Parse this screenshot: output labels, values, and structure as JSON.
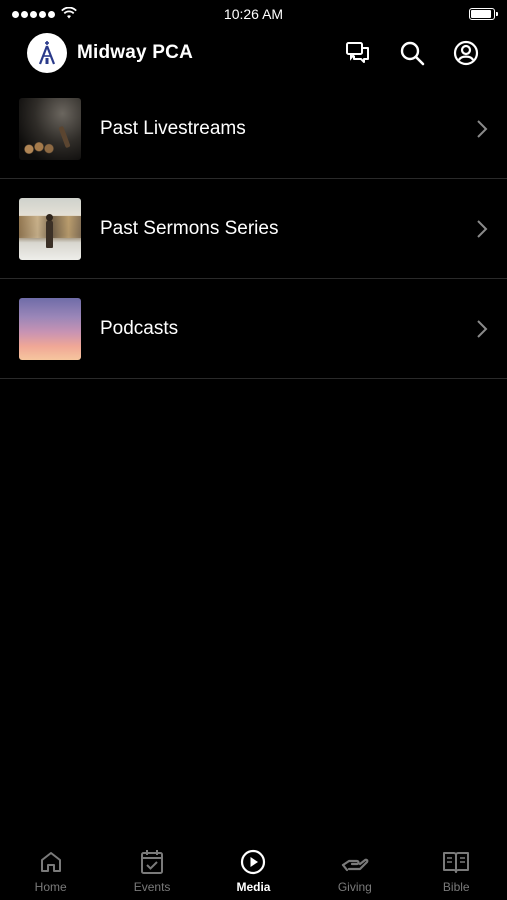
{
  "status_bar": {
    "time": "10:26 AM",
    "signal_icon": "signal-dots-icon",
    "wifi_icon": "wifi-icon",
    "battery_icon": "battery-icon",
    "battery_level": 0.9
  },
  "header": {
    "title": "Midway PCA",
    "logo_icon": "church-logo-icon",
    "actions": [
      {
        "icon": "chat-icon"
      },
      {
        "icon": "search-icon"
      },
      {
        "icon": "account-icon"
      }
    ]
  },
  "media": {
    "items": [
      {
        "label": "Past Livestreams",
        "thumbnail": "livestream-thumbnail"
      },
      {
        "label": "Past Sermons Series",
        "thumbnail": "sermons-thumbnail"
      },
      {
        "label": "Podcasts",
        "thumbnail": "podcasts-thumbnail"
      }
    ]
  },
  "tabs": [
    {
      "label": "Home",
      "icon": "home-icon",
      "active": false
    },
    {
      "label": "Events",
      "icon": "calendar-icon",
      "active": false
    },
    {
      "label": "Media",
      "icon": "play-icon",
      "active": true
    },
    {
      "label": "Giving",
      "icon": "giving-hand-icon",
      "active": false
    },
    {
      "label": "Bible",
      "icon": "book-icon",
      "active": false
    }
  ],
  "colors": {
    "background": "#000000",
    "text": "#ffffff",
    "inactive_tab": "#7a7a7a",
    "divider": "#2a2a2a"
  }
}
